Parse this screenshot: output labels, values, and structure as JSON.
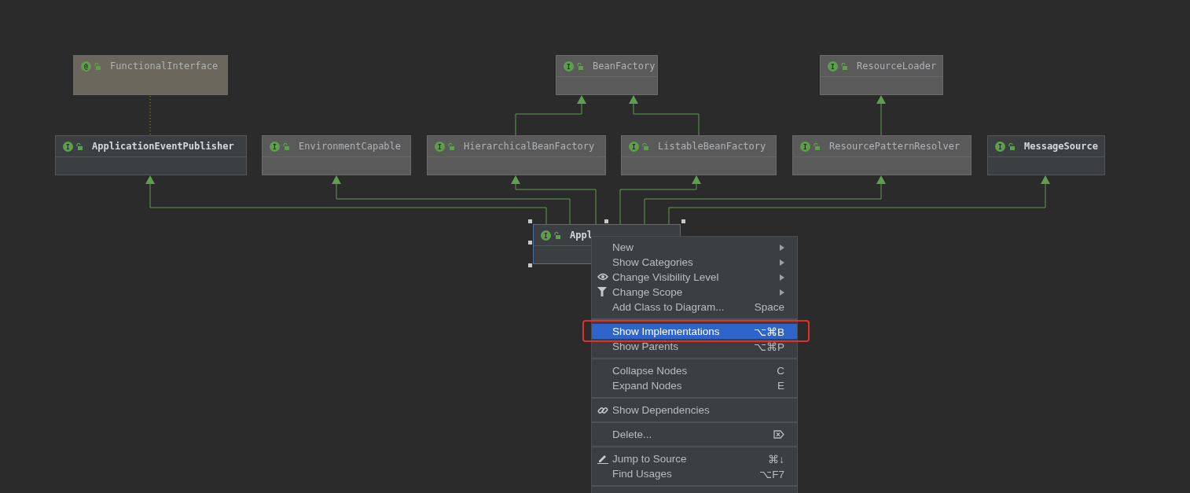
{
  "diagram": {
    "nodes": [
      {
        "name": "FunctionalInterface",
        "badge": "@",
        "kind": "annotation",
        "emphasized": false,
        "selected": false
      },
      {
        "name": "BeanFactory",
        "badge": "I",
        "kind": "interface",
        "emphasized": false,
        "selected": false
      },
      {
        "name": "ResourceLoader",
        "badge": "I",
        "kind": "interface",
        "emphasized": false,
        "selected": false
      },
      {
        "name": "ApplicationEventPublisher",
        "badge": "I",
        "kind": "interface",
        "emphasized": true,
        "selected": false
      },
      {
        "name": "EnvironmentCapable",
        "badge": "I",
        "kind": "interface",
        "emphasized": false,
        "selected": false
      },
      {
        "name": "HierarchicalBeanFactory",
        "badge": "I",
        "kind": "interface",
        "emphasized": false,
        "selected": false
      },
      {
        "name": "ListableBeanFactory",
        "badge": "I",
        "kind": "interface",
        "emphasized": false,
        "selected": false
      },
      {
        "name": "ResourcePatternResolver",
        "badge": "I",
        "kind": "interface",
        "emphasized": false,
        "selected": false
      },
      {
        "name": "MessageSource",
        "badge": "I",
        "kind": "interface",
        "emphasized": true,
        "selected": false
      },
      {
        "name": "Appl",
        "badge": "I",
        "kind": "interface",
        "emphasized": true,
        "selected": true
      }
    ]
  },
  "context_menu": {
    "items": [
      {
        "kind": "item",
        "label": "New",
        "submenu": true,
        "selected": false
      },
      {
        "kind": "item",
        "label": "Show Categories",
        "submenu": true,
        "selected": false
      },
      {
        "kind": "item",
        "label": "Change Visibility Level",
        "submenu": true,
        "selected": false
      },
      {
        "kind": "item",
        "label": "Change Scope",
        "submenu": true,
        "selected": false
      },
      {
        "kind": "item",
        "label": "Add Class to Diagram...",
        "shortcut": "Space",
        "selected": false
      },
      {
        "kind": "separator"
      },
      {
        "kind": "item",
        "label": "Show Implementations",
        "shortcut": "⌥⌘B",
        "selected": true,
        "outlined": true
      },
      {
        "kind": "item",
        "label": "Show Parents",
        "shortcut": "⌥⌘P",
        "selected": false
      },
      {
        "kind": "separator"
      },
      {
        "kind": "item",
        "label": "Collapse Nodes",
        "shortcut": "C",
        "selected": false
      },
      {
        "kind": "item",
        "label": "Expand Nodes",
        "shortcut": "E",
        "selected": false
      },
      {
        "kind": "separator"
      },
      {
        "kind": "item",
        "label": "Show Dependencies",
        "selected": false
      },
      {
        "kind": "separator"
      },
      {
        "kind": "item",
        "label": "Delete...",
        "selected": false
      },
      {
        "kind": "separator"
      },
      {
        "kind": "item",
        "label": "Jump to Source",
        "shortcut": "⌘↓",
        "selected": false
      },
      {
        "kind": "item",
        "label": "Find Usages",
        "shortcut": "⌥F7",
        "selected": false
      },
      {
        "kind": "separator"
      }
    ]
  }
}
